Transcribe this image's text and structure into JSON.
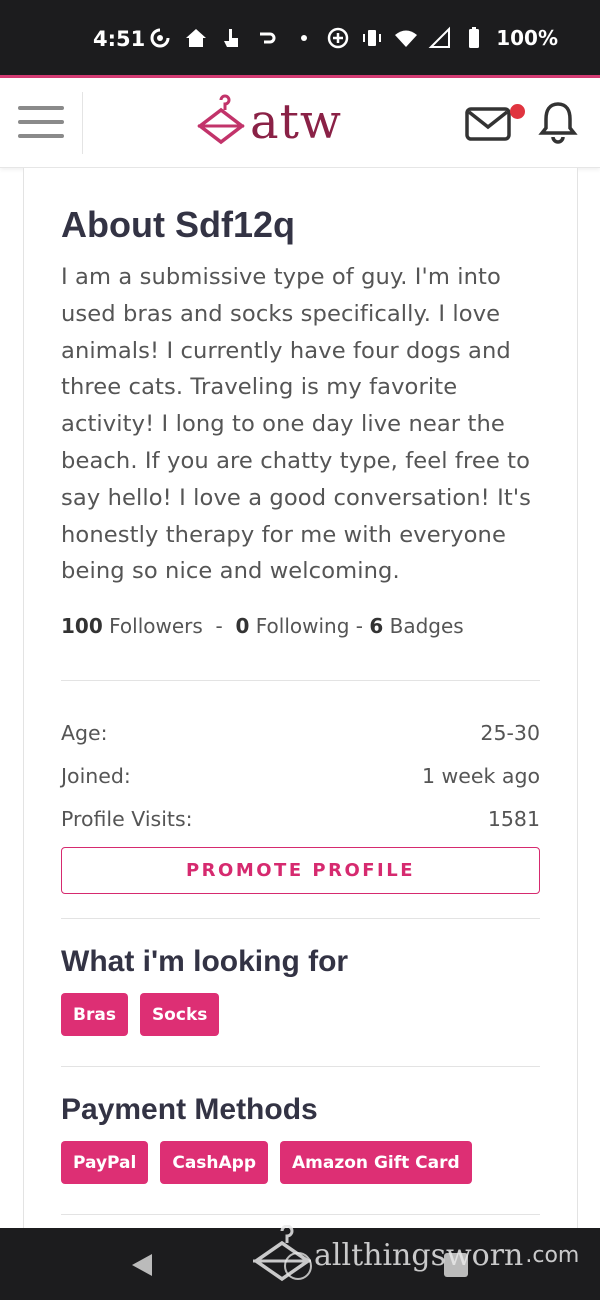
{
  "status_bar": {
    "time": "4:51",
    "battery": "100%"
  },
  "header": {
    "logo_text": "atw",
    "mail_unread": true
  },
  "profile": {
    "heading": "About Sdf12q",
    "bio": "I am a submissive type of guy. I'm into used bras and socks specifically. I love animals! I currently have four dogs and three cats. Traveling is my favorite activity! I long to one day live near the beach. If you are chatty type, feel free to say hello! I love a good conversation! It's honestly therapy for me with everyone being so nice and welcoming.",
    "followers_count": "100",
    "followers_label": "Followers",
    "following_count": "0",
    "following_label": "Following",
    "badges_count": "6",
    "badges_label": "Badges",
    "sep": "-"
  },
  "info": {
    "age_label": "Age:",
    "age_value": "25-30",
    "joined_label": "Joined:",
    "joined_value": "1 week ago",
    "visits_label": "Profile Visits:",
    "visits_value": "1581"
  },
  "promote_label": "PROMOTE PROFILE",
  "looking_for": {
    "heading": "What i'm looking for",
    "tags": [
      "Bras",
      "Socks"
    ]
  },
  "payment": {
    "heading": "Payment Methods",
    "tags": [
      "PayPal",
      "CashApp",
      "Amazon Gift Card"
    ]
  },
  "watermark": {
    "text": "allthingsworn",
    "suffix": ".com"
  },
  "colors": {
    "accent": "#dd2f74",
    "brand": "#8a2146",
    "status_bar": "#1c1c1e"
  }
}
